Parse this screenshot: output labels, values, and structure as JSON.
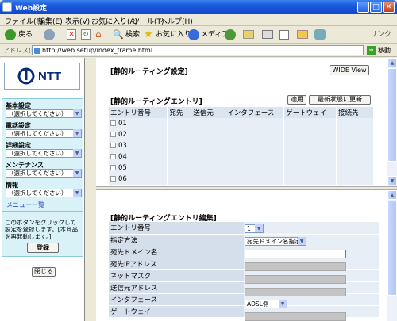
{
  "window": {
    "title": "Web設定",
    "btn_min": "_",
    "btn_max": "□",
    "btn_close": "✕"
  },
  "menu": [
    "ファイル(F)",
    "編集(E)",
    "表示(V)",
    "お気に入り(A)",
    "ツール(T)",
    "ヘルプ(H)"
  ],
  "toolbar": {
    "back": "戻る",
    "search": "検索",
    "favorites": "お気に入り",
    "media": "メディア",
    "links": "リンク"
  },
  "address": {
    "label": "アドレス(D)",
    "url": "http://web.setup/index_frame.html",
    "go": "移動"
  },
  "left": {
    "logo": "NTT",
    "sections": [
      {
        "label": "基本設定",
        "select": "（選択してください）"
      },
      {
        "label": "電話設定",
        "select": "（選択してください）"
      },
      {
        "label": "詳細設定",
        "select": "（選択してください）"
      },
      {
        "label": "メンテナンス",
        "select": "（選択してください）"
      },
      {
        "label": "情報",
        "select": "（選択してください）"
      }
    ],
    "menu_list": "メニュー一覧",
    "info_text": "このボタンをクリックして設定を登録します。[本商品を再起動します。]",
    "register_button": "登録",
    "close_button": "閉じる"
  },
  "top": {
    "title": "[静的ルーティング設定]",
    "wide_view": "WIDE View",
    "entry_title": "[静的ルーティングエントリ]",
    "apply_button": "適用",
    "refresh_button": "最新状態に更新",
    "headers": [
      "エントリ番号",
      "宛先",
      "送信元",
      "インタフェース",
      "ゲートウェイ",
      "接続先"
    ],
    "rows": [
      "01",
      "02",
      "03",
      "04",
      "05",
      "06"
    ]
  },
  "edit": {
    "title": "[静的ルーティングエントリ編集]",
    "fields": [
      {
        "label": "エントリ番号",
        "value": "1"
      },
      {
        "label": "指定方法",
        "value": "宛先ドメイン名指定"
      },
      {
        "label": "宛先ドメイン名",
        "value": ""
      },
      {
        "label": "宛先IPアドレス",
        "value": ""
      },
      {
        "label": "ネットマスク",
        "value": ""
      },
      {
        "label": "送信元アドレス",
        "value": ""
      },
      {
        "label": "インタフェース",
        "value": "ADSL側"
      },
      {
        "label": "ゲートウェイ",
        "value": ""
      }
    ]
  }
}
